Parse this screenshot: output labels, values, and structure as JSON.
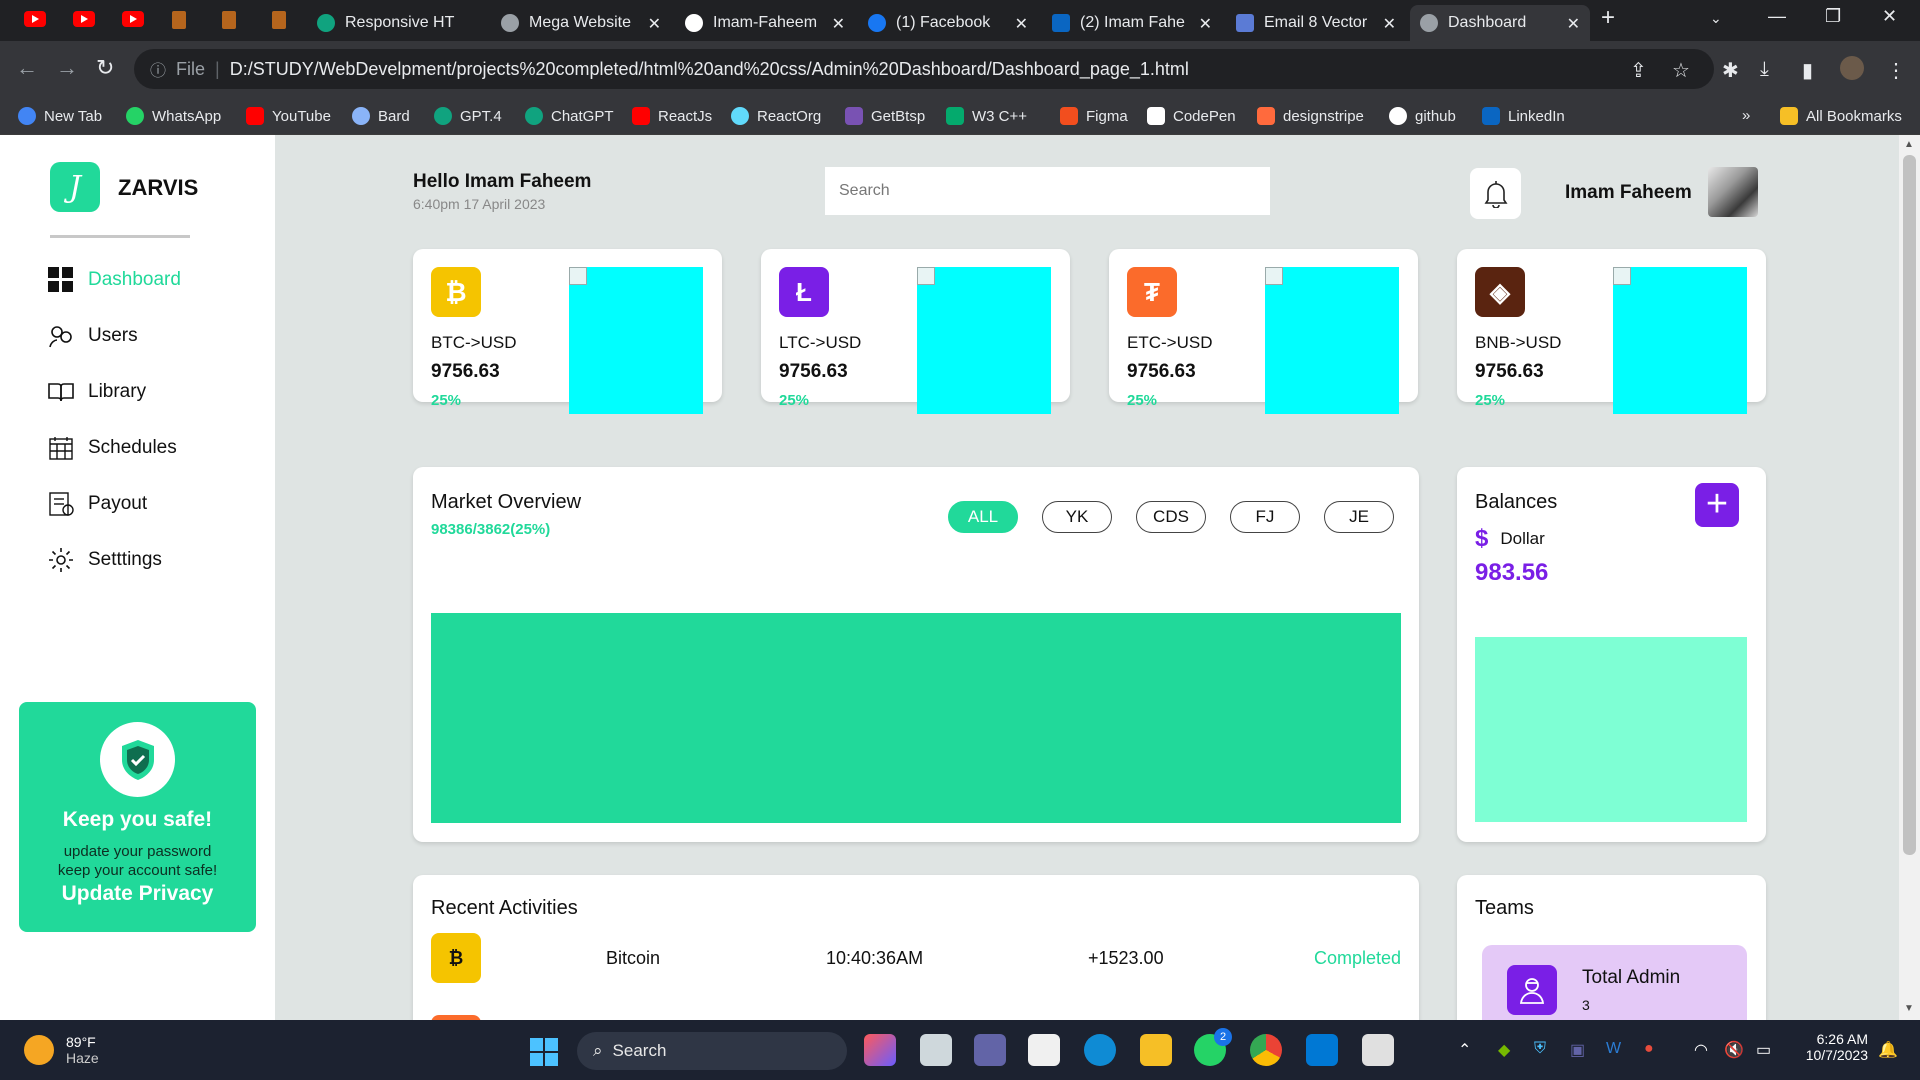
{
  "browser": {
    "tabs": [
      {
        "title": "Responsive HT",
        "icon": "chatgpt-icon"
      },
      {
        "title": "Mega Website",
        "icon": "globe-icon"
      },
      {
        "title": "Imam-Faheem",
        "icon": "github-icon"
      },
      {
        "title": "(1) Facebook",
        "icon": "facebook-icon"
      },
      {
        "title": "(2) Imam Fahe",
        "icon": "linkedin-icon"
      },
      {
        "title": "Email 8 Vector",
        "icon": "repo-icon"
      },
      {
        "title": "Dashboard",
        "icon": "globe-icon"
      }
    ],
    "address": {
      "scheme_label": "File",
      "url": "D:/STUDY/WebDevelpment/projects%20completed/html%20and%20css/Admin%20Dashboard/Dashboard_page_1.html"
    },
    "bookmarks": [
      {
        "label": "New Tab",
        "color": "#4285f4"
      },
      {
        "label": "WhatsApp",
        "color": "#25d366"
      },
      {
        "label": "YouTube",
        "color": "#ff0000"
      },
      {
        "label": "Bard",
        "color": "#8ab4f8"
      },
      {
        "label": "GPT.4",
        "color": "#10a37f"
      },
      {
        "label": "ChatGPT",
        "color": "#10a37f"
      },
      {
        "label": "ReactJs",
        "color": "#ff0000"
      },
      {
        "label": "ReactOrg",
        "color": "#61dafb"
      },
      {
        "label": "GetBtsp",
        "color": "#7952b3"
      },
      {
        "label": "W3 C++",
        "color": "#04aa6d"
      },
      {
        "label": "Figma",
        "color": "#f24e1e"
      },
      {
        "label": "CodePen",
        "color": "#ffffff"
      },
      {
        "label": "designstripe",
        "color": "#ff6a3d"
      },
      {
        "label": "github",
        "color": "#ffffff"
      },
      {
        "label": "LinkedIn",
        "color": "#0a66c2"
      }
    ],
    "all_bookmarks": "All Bookmarks"
  },
  "sidebar": {
    "brand": "ZARVIS",
    "logo_letter": "J",
    "menu": [
      {
        "label": "Dashboard",
        "icon": "grid-icon",
        "active": true
      },
      {
        "label": "Users",
        "icon": "users-icon",
        "active": false
      },
      {
        "label": "Library",
        "icon": "book-icon",
        "active": false
      },
      {
        "label": "Schedules",
        "icon": "calendar-icon",
        "active": false
      },
      {
        "label": "Payout",
        "icon": "payout-icon",
        "active": false
      },
      {
        "label": "Setttings",
        "icon": "gear-icon",
        "active": false
      }
    ],
    "safe_card": {
      "title": "Keep you safe!",
      "line1": "update your password",
      "line2": "keep your account safe!",
      "button": "Update Privacy"
    }
  },
  "header": {
    "greeting": "Hello Imam Faheem",
    "datetime": "6:40pm 17 April 2023",
    "search_placeholder": "Search",
    "user_name": "Imam Faheem"
  },
  "crypto_cards": [
    {
      "pair": "BTC->USD",
      "price": "9756.63",
      "change": "25%",
      "coin_icon": "bitcoin-icon",
      "coin_symbol": "₿",
      "color": "#f5c400"
    },
    {
      "pair": "LTC->USD",
      "price": "9756.63",
      "change": "25%",
      "coin_icon": "litecoin-icon",
      "coin_symbol": "Ł",
      "color": "#7a1fe6"
    },
    {
      "pair": "ETC->USD",
      "price": "9756.63",
      "change": "25%",
      "coin_icon": "tether-icon",
      "coin_symbol": "₮",
      "color": "#fb6b2b"
    },
    {
      "pair": "BNB->USD",
      "price": "9756.63",
      "change": "25%",
      "coin_icon": "binance-icon",
      "coin_symbol": "◈",
      "color": "#5a2410"
    }
  ],
  "market": {
    "title": "Market Overview",
    "subtitle": "98386/3862(25%)",
    "filters": [
      "ALL",
      "YK",
      "CDS",
      "FJ",
      "JE"
    ],
    "active_filter": "ALL",
    "color": "#21d99a"
  },
  "balances": {
    "title": "Balances",
    "currency_symbol": "$",
    "currency": "Dollar",
    "amount": "983.56",
    "color": "#7a1fe6"
  },
  "recent": {
    "title": "Recent Activities",
    "rows": [
      {
        "name": "Bitcoin",
        "time": "10:40:36AM",
        "amount": "+1523.00",
        "status": "Completed",
        "coin_symbol": "₿"
      }
    ]
  },
  "teams": {
    "title": "Teams",
    "cards": [
      {
        "label": "Total Admin",
        "count": "3"
      }
    ]
  },
  "taskbar": {
    "weather_temp": "89°F",
    "weather_desc": "Haze",
    "search_label": "Search",
    "time": "6:26 AM",
    "date": "10/7/2023",
    "badge_count": "2"
  }
}
